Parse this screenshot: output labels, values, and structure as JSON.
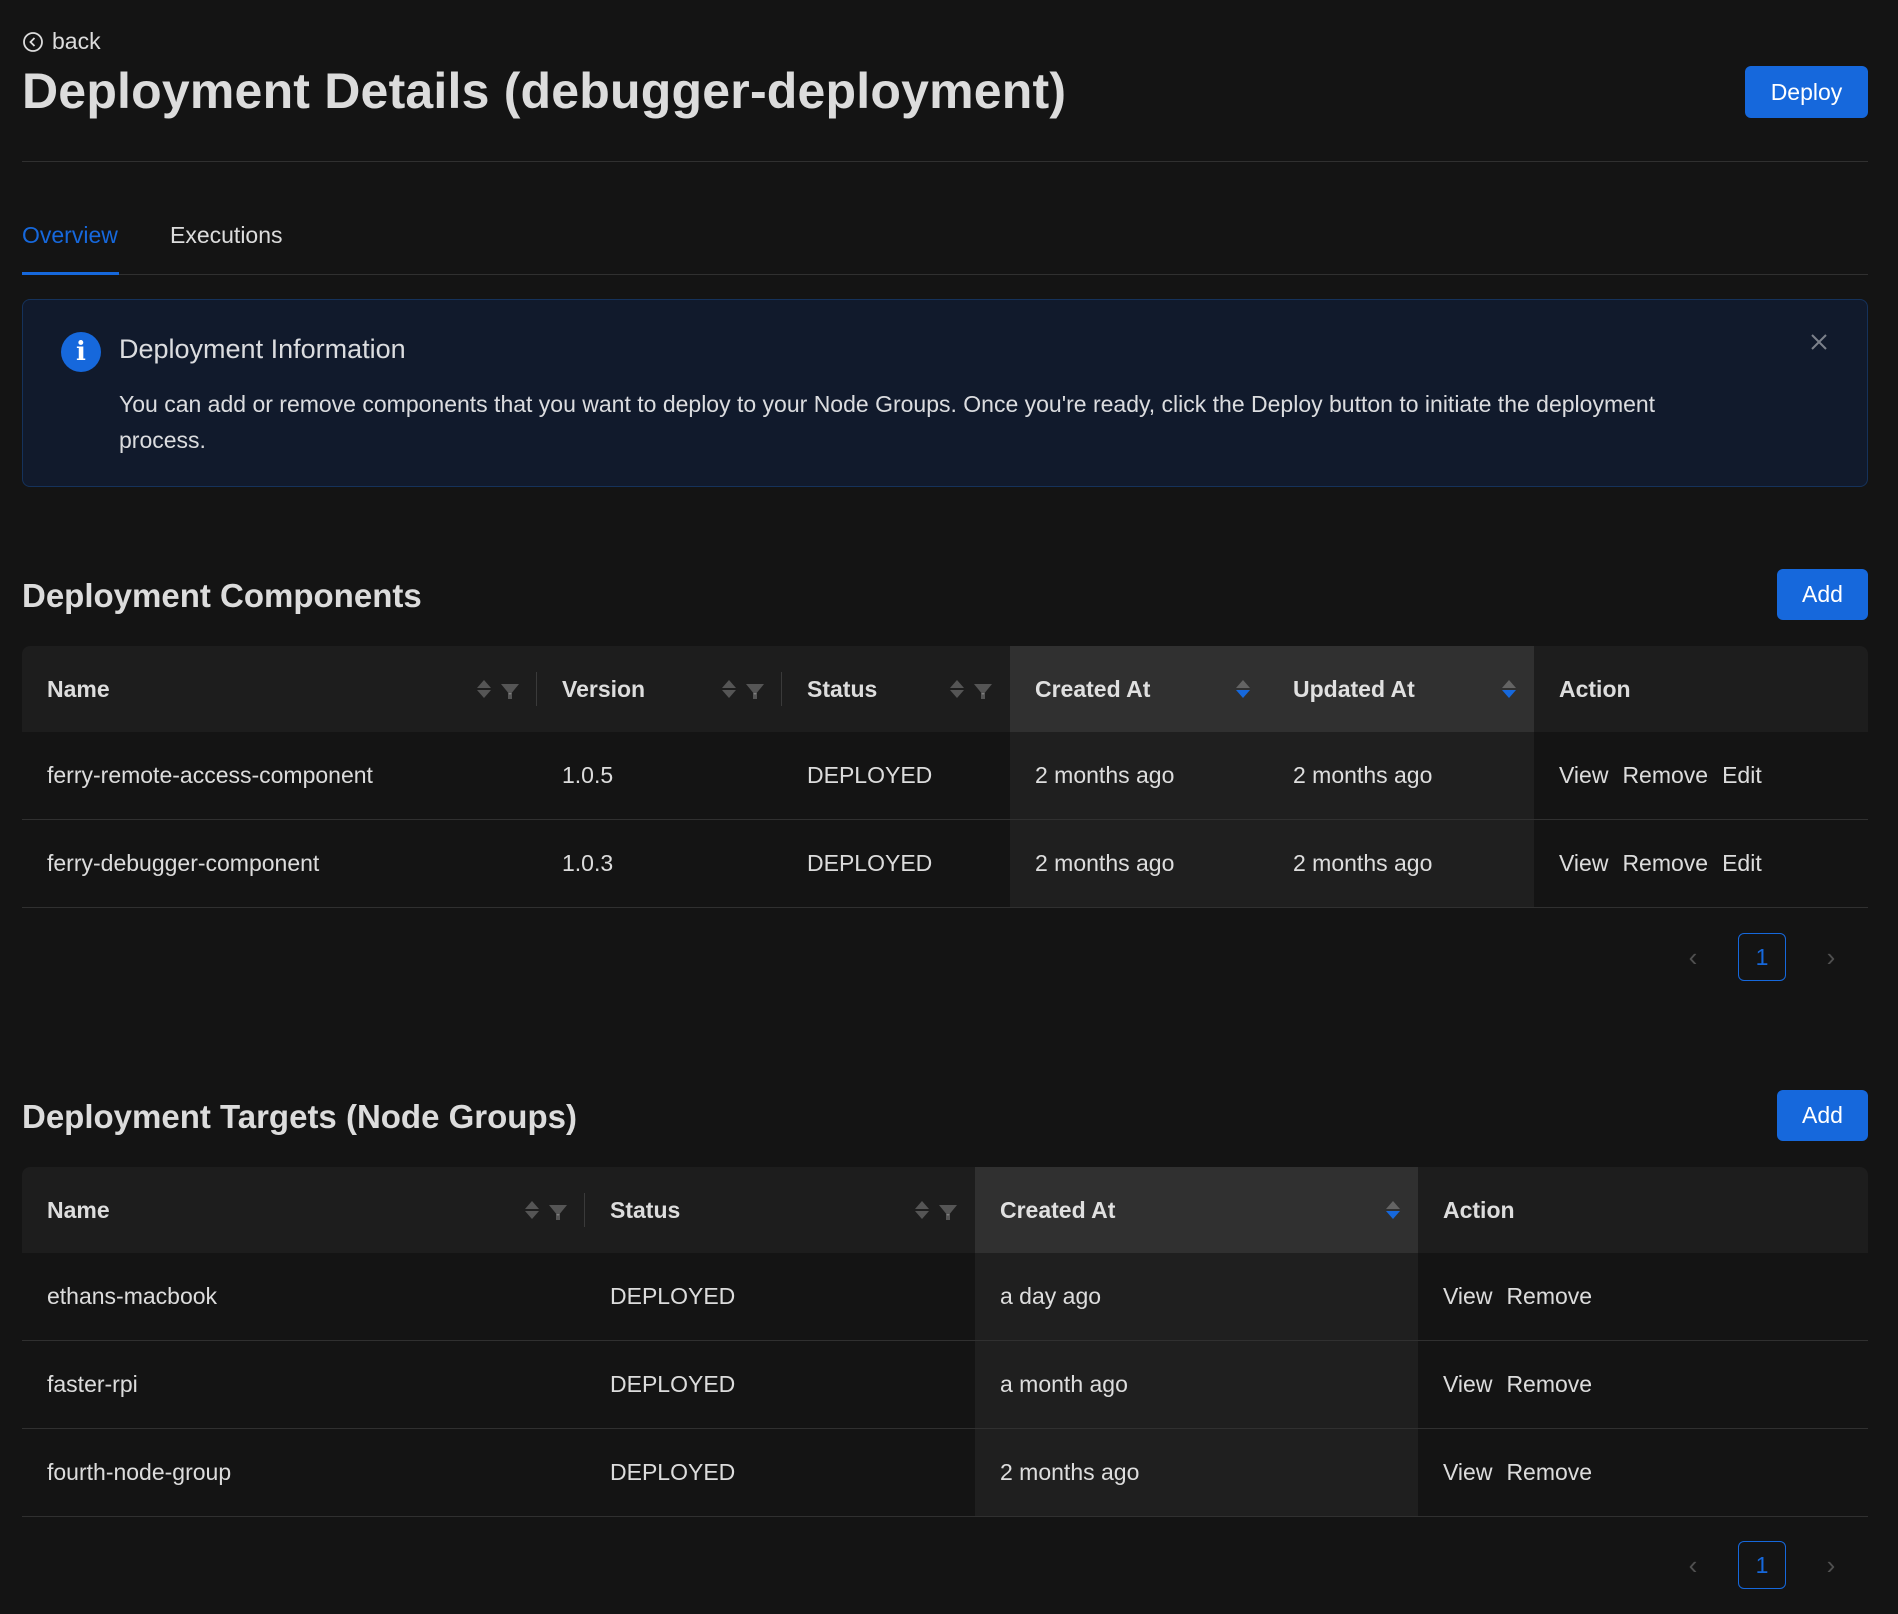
{
  "header": {
    "back_label": "back",
    "title": "Deployment Details (debugger-deployment)",
    "deploy_label": "Deploy"
  },
  "tabs": [
    {
      "label": "Overview",
      "active": true
    },
    {
      "label": "Executions",
      "active": false
    }
  ],
  "alert": {
    "title": "Deployment Information",
    "description": "You can add or remove components that you want to deploy to your Node Groups. Once you're ready, click the Deploy button to initiate the deployment process."
  },
  "components": {
    "title": "Deployment Components",
    "add_label": "Add",
    "columns": [
      "Name",
      "Version",
      "Status",
      "Created At",
      "Updated At",
      "Action"
    ],
    "rows": [
      {
        "name": "ferry-remote-access-component",
        "version": "1.0.5",
        "status": "DEPLOYED",
        "created": "2 months ago",
        "updated": "2 months ago",
        "actions": [
          "View",
          "Remove",
          "Edit"
        ]
      },
      {
        "name": "ferry-debugger-component",
        "version": "1.0.3",
        "status": "DEPLOYED",
        "created": "2 months ago",
        "updated": "2 months ago",
        "actions": [
          "View",
          "Remove",
          "Edit"
        ]
      }
    ],
    "page": "1"
  },
  "targets": {
    "title": "Deployment Targets (Node Groups)",
    "add_label": "Add",
    "columns": [
      "Name",
      "Status",
      "Created At",
      "Action"
    ],
    "rows": [
      {
        "name": "ethans-macbook",
        "status": "DEPLOYED",
        "created": "a day ago",
        "actions": [
          "View",
          "Remove"
        ]
      },
      {
        "name": "faster-rpi",
        "status": "DEPLOYED",
        "created": "a month ago",
        "actions": [
          "View",
          "Remove"
        ]
      },
      {
        "name": "fourth-node-group",
        "status": "DEPLOYED",
        "created": "2 months ago",
        "actions": [
          "View",
          "Remove"
        ]
      }
    ],
    "page": "1"
  },
  "colors": {
    "accent": "#1668dc",
    "background": "#141414",
    "alert_bg": "#111a2c"
  },
  "icons": [
    "arrow-left-circle-icon",
    "info-icon",
    "close-icon",
    "sort-icon",
    "filter-icon",
    "chevron-left-icon",
    "chevron-right-icon"
  ]
}
